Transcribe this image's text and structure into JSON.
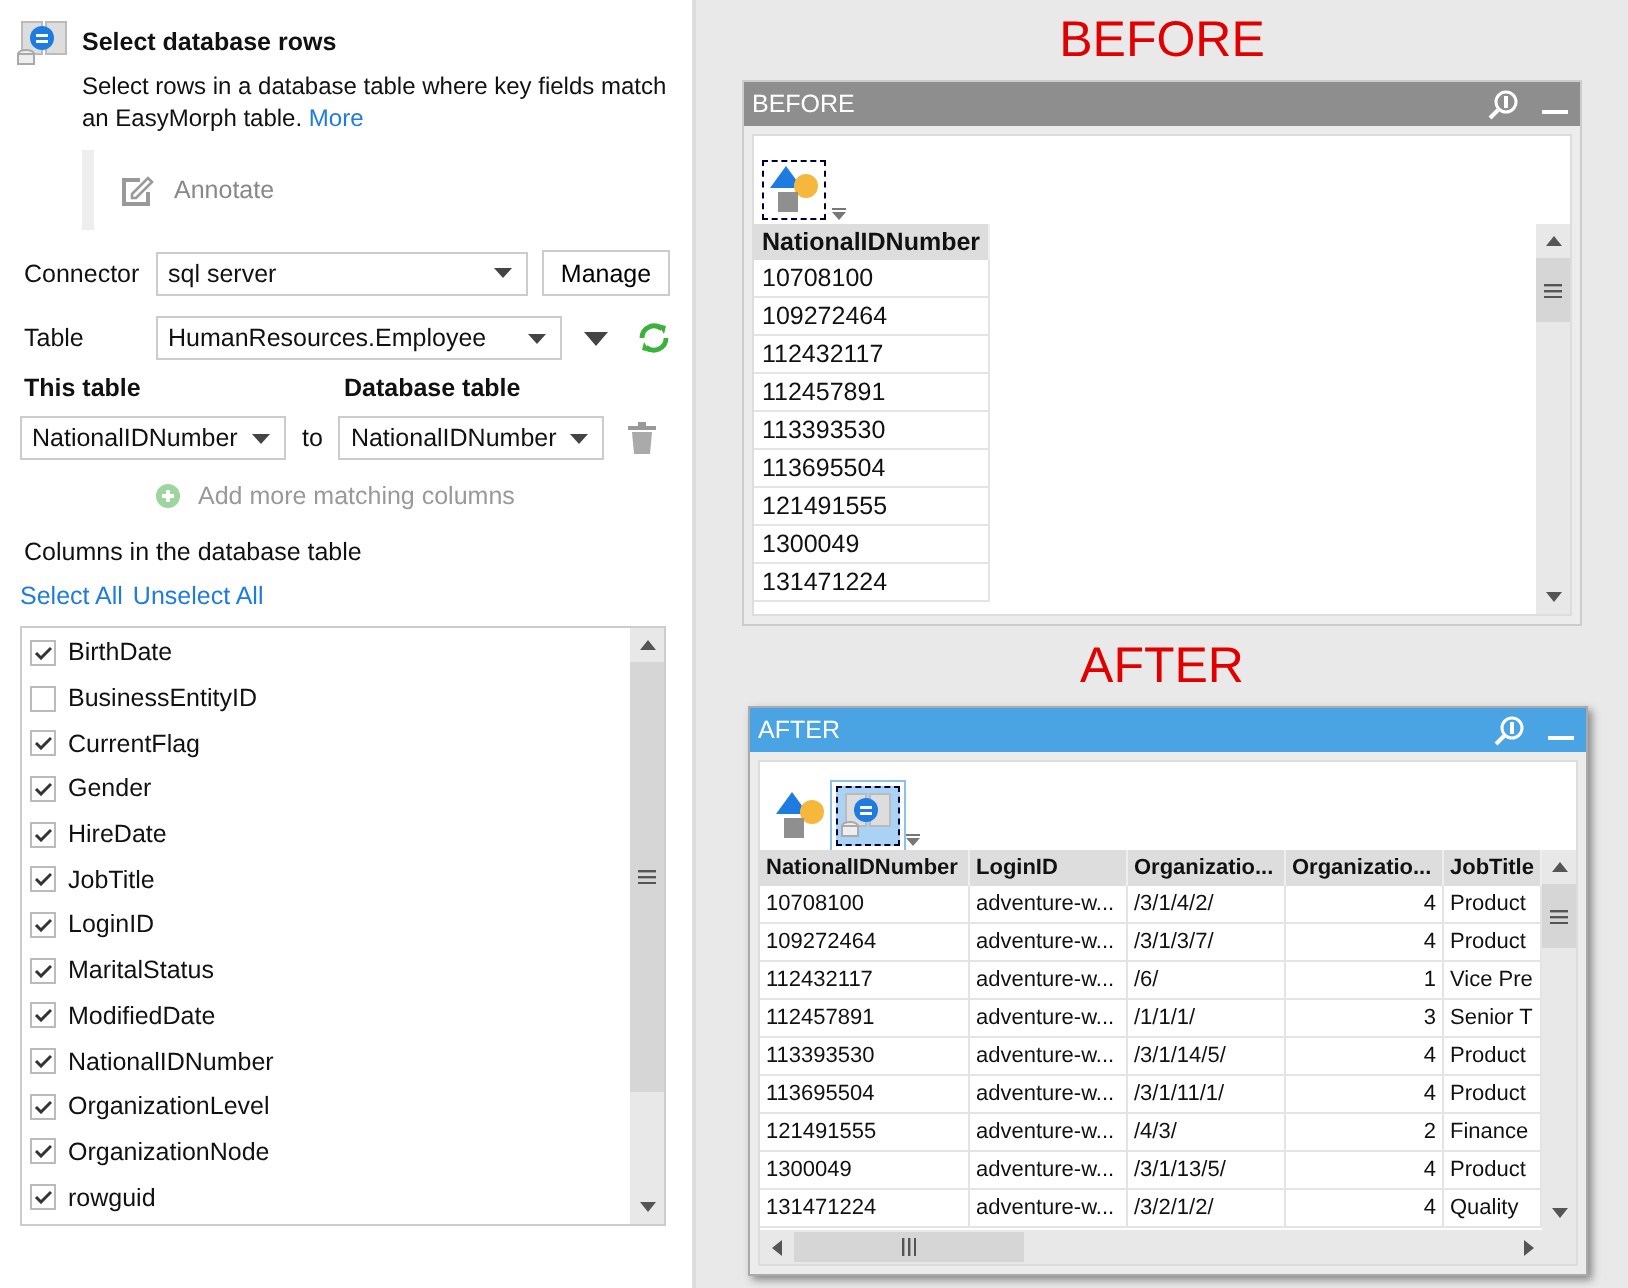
{
  "settings": {
    "title": "Select database rows",
    "description": "Select rows in a database table where key fields match an EasyMorph table.",
    "more_link": "More",
    "annotate": "Annotate",
    "connector": {
      "label": "Connector",
      "value": "sql server",
      "button": "Manage"
    },
    "table": {
      "label": "Table",
      "value": "HumanResources.Employee"
    },
    "match_headers": [
      "This table",
      "Database table"
    ],
    "match": {
      "this_value": "NationalIDNumber",
      "joiner": "to",
      "db_value": "NationalIDNumber"
    },
    "add_more": "Add more matching columns",
    "columns_heading": "Columns in the database table",
    "select_all": "Select All",
    "unselect_all": "Unselect All",
    "columns": [
      {
        "label": "BirthDate",
        "checked": true
      },
      {
        "label": "BusinessEntityID",
        "checked": false
      },
      {
        "label": "CurrentFlag",
        "checked": true
      },
      {
        "label": "Gender",
        "checked": true
      },
      {
        "label": "HireDate",
        "checked": true
      },
      {
        "label": "JobTitle",
        "checked": true
      },
      {
        "label": "LoginID",
        "checked": true
      },
      {
        "label": "MaritalStatus",
        "checked": true
      },
      {
        "label": "ModifiedDate",
        "checked": true
      },
      {
        "label": "NationalIDNumber",
        "checked": true
      },
      {
        "label": "OrganizationLevel",
        "checked": true
      },
      {
        "label": "OrganizationNode",
        "checked": true
      },
      {
        "label": "rowguid",
        "checked": true
      }
    ]
  },
  "previews": [
    {
      "heading": "BEFORE",
      "title": "BEFORE",
      "active": false,
      "steps": [
        {
          "kind": "source",
          "selected": true
        }
      ],
      "columns": [
        {
          "label": "NationalIDNumber",
          "numeric": false
        }
      ],
      "rows": [
        [
          "10708100"
        ],
        [
          "109272464"
        ],
        [
          "112432117"
        ],
        [
          "112457891"
        ],
        [
          "113393530"
        ],
        [
          "113695504"
        ],
        [
          "121491555"
        ],
        [
          "1300049"
        ],
        [
          "131471224"
        ]
      ],
      "horizontal_scroll": false
    },
    {
      "heading": "AFTER",
      "title": "AFTER",
      "active": true,
      "steps": [
        {
          "kind": "source",
          "selected": false
        },
        {
          "kind": "select-db",
          "selected": true
        }
      ],
      "columns": [
        {
          "label": "NationalIDNumber",
          "numeric": false
        },
        {
          "label": "LoginID",
          "numeric": false
        },
        {
          "label": "Organizatio...",
          "numeric": false
        },
        {
          "label": "Organizatio...",
          "numeric": true
        },
        {
          "label": "JobTitle",
          "numeric": false
        }
      ],
      "rows": [
        [
          "10708100",
          "adventure-w...",
          "/3/1/4/2/",
          "4",
          "Product"
        ],
        [
          "109272464",
          "adventure-w...",
          "/3/1/3/7/",
          "4",
          "Product"
        ],
        [
          "112432117",
          "adventure-w...",
          "/6/",
          "1",
          "Vice Pre"
        ],
        [
          "112457891",
          "adventure-w...",
          "/1/1/1/",
          "3",
          "Senior T"
        ],
        [
          "113393530",
          "adventure-w...",
          "/3/1/14/5/",
          "4",
          "Product"
        ],
        [
          "113695504",
          "adventure-w...",
          "/3/1/11/1/",
          "4",
          "Product"
        ],
        [
          "121491555",
          "adventure-w...",
          "/4/3/",
          "2",
          "Finance"
        ],
        [
          "1300049",
          "adventure-w...",
          "/3/1/13/5/",
          "4",
          "Product"
        ],
        [
          "131471224",
          "adventure-w...",
          "/3/2/1/2/",
          "4",
          "Quality"
        ]
      ],
      "horizontal_scroll": true
    }
  ]
}
